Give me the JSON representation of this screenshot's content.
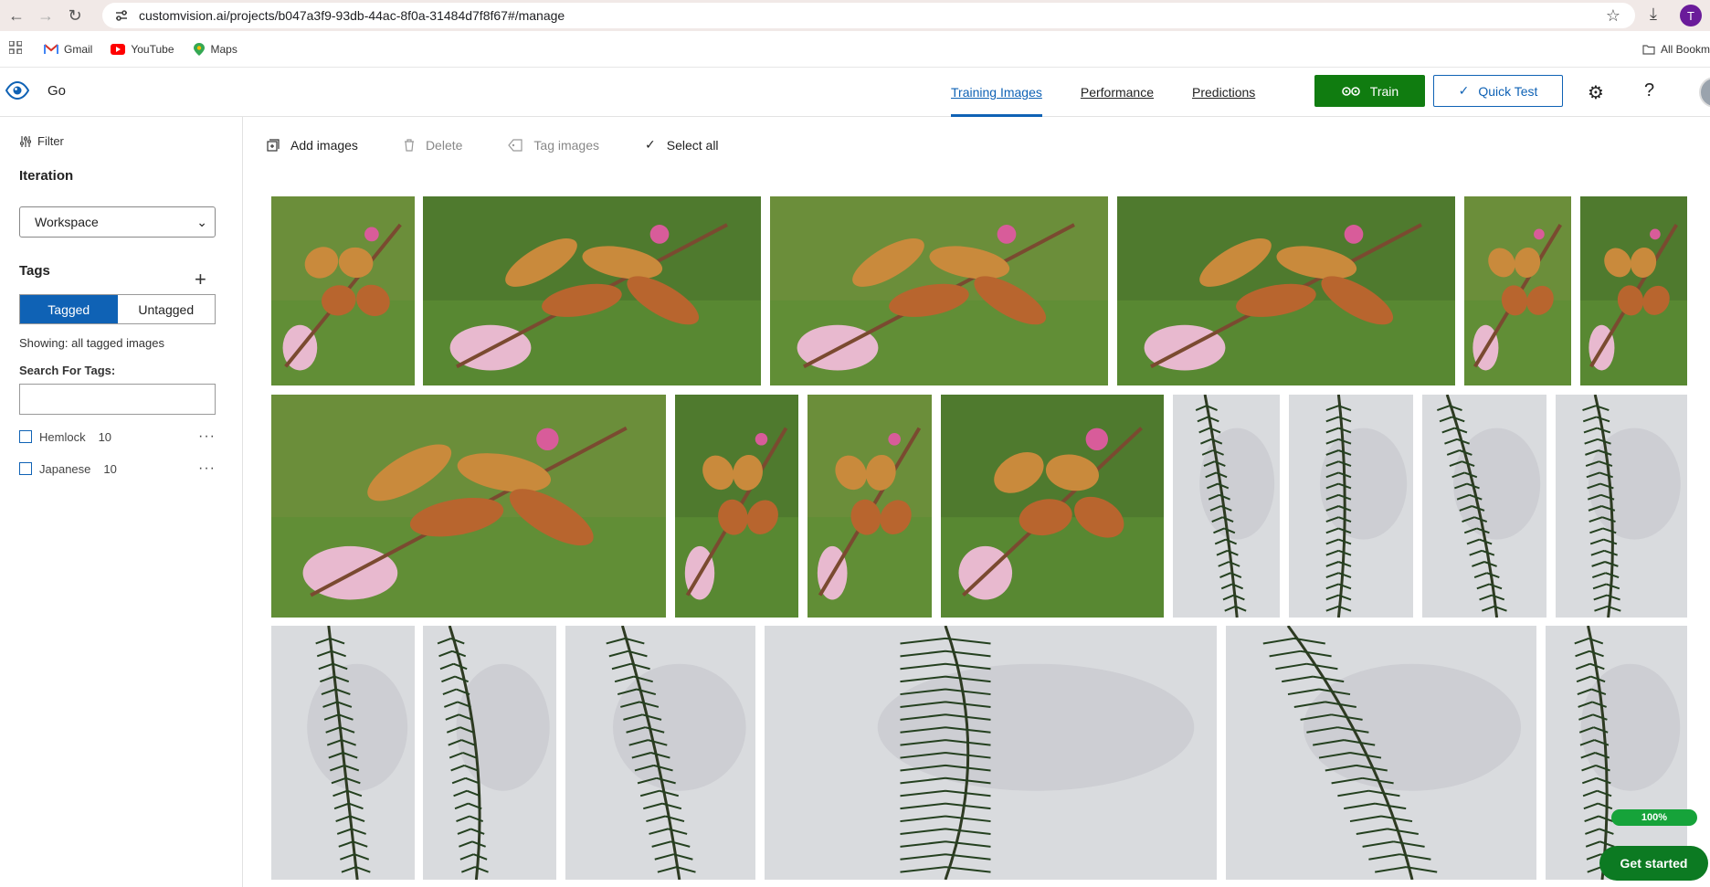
{
  "browser": {
    "url": "customvision.ai/projects/b047a3f9-93db-44ac-8f0a-31484d7f8f67#/manage",
    "profile_initial": "T",
    "bookmarks": [
      {
        "label": "Gmail",
        "icon": "gmail-icon"
      },
      {
        "label": "YouTube",
        "icon": "youtube-icon"
      },
      {
        "label": "Maps",
        "icon": "maps-icon"
      }
    ],
    "all_bookmarks": "All Bookm"
  },
  "header": {
    "project_name": "Go",
    "tabs": [
      {
        "label": "Training Images",
        "active": true
      },
      {
        "label": "Performance",
        "active": false
      },
      {
        "label": "Predictions",
        "active": false
      }
    ],
    "train_label": "Train",
    "quick_test_label": "Quick Test",
    "help_label": "?"
  },
  "sidebar": {
    "filter_label": "Filter",
    "iteration_title": "Iteration",
    "iteration_value": "Workspace",
    "tags_title": "Tags",
    "toggle": {
      "tagged": "Tagged",
      "untagged": "Untagged"
    },
    "showing_text": "Showing: all tagged images",
    "search_label": "Search For Tags:",
    "search_value": "",
    "tags": [
      {
        "name": "Hemlock",
        "count": "10"
      },
      {
        "name": "Japanese",
        "count": "10"
      }
    ]
  },
  "toolbar": {
    "add_images": "Add images",
    "delete": "Delete",
    "tag_images": "Tag images",
    "select_all": "Select all"
  },
  "images": [
    {
      "kind": "cherry"
    },
    {
      "kind": "cherry"
    },
    {
      "kind": "cherry"
    },
    {
      "kind": "cherry"
    },
    {
      "kind": "cherry"
    },
    {
      "kind": "cherry"
    },
    {
      "kind": "cherry"
    },
    {
      "kind": "cherry"
    },
    {
      "kind": "cherry"
    },
    {
      "kind": "cherry"
    },
    {
      "kind": "hemlock"
    },
    {
      "kind": "hemlock"
    },
    {
      "kind": "hemlock"
    },
    {
      "kind": "hemlock"
    },
    {
      "kind": "hemlock"
    },
    {
      "kind": "hemlock"
    },
    {
      "kind": "hemlock"
    },
    {
      "kind": "hemlock"
    },
    {
      "kind": "hemlock"
    },
    {
      "kind": "hemlock"
    }
  ],
  "colors": {
    "accent": "#0f62b5",
    "train_green": "#107c10"
  },
  "progress_label": "100%",
  "get_started_label": "Get started"
}
